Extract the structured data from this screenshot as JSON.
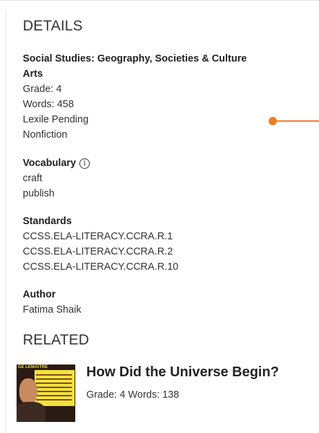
{
  "details": {
    "heading": "DETAILS",
    "subjects": [
      "Social Studies: Geography, Societies & Culture",
      "Arts"
    ],
    "grade": "Grade: 4",
    "words": "Words: 458",
    "lexile": "Lexile Pending",
    "genre": "Nonfiction"
  },
  "vocabulary": {
    "heading": "Vocabulary",
    "info_icon": "i",
    "words": [
      "craft",
      "publish"
    ]
  },
  "standards": {
    "heading": "Standards",
    "items": [
      "CCSS.ELA-LITERACY.CCRA.R.1",
      "CCSS.ELA-LITERACY.CCRA.R.2",
      "CCSS.ELA-LITERACY.CCRA.R.10"
    ]
  },
  "author": {
    "heading": "Author",
    "name": "Fatima Shaik"
  },
  "related": {
    "heading": "RELATED",
    "items": [
      {
        "title": "How Did the Universe Begin?",
        "meta": "Grade: 4 Words: 138",
        "thumb_caption": "GE LEMAITRE"
      }
    ]
  },
  "colors": {
    "accent": "#f07d28",
    "text": "#333333"
  }
}
